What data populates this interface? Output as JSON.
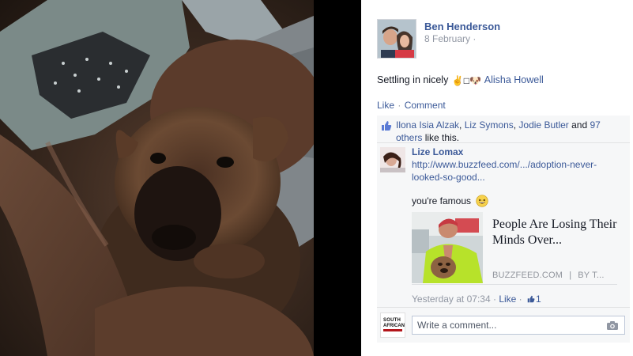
{
  "post": {
    "author": "Ben Henderson",
    "date": "8 February ·",
    "text": "Settling in nicely",
    "emoji_text": "✌️□🐶",
    "tagged": "Alisha Howell"
  },
  "actions": {
    "like": "Like",
    "separator": "·",
    "comment": "Comment"
  },
  "likes": {
    "names": [
      "Ilona Isia Alzak",
      "Liz Symons",
      "Jodie Butler"
    ],
    "sep1": ", ",
    "sep2": ", ",
    "and_text": " and ",
    "others_link": "97 others",
    "suffix": " like this."
  },
  "comment": {
    "author": "Lize Lomax",
    "url": "http://www.buzzfeed.com/.../adoption-never-looked-so-good...",
    "text": "you're famous",
    "preview": {
      "title": "People Are Losing Their Minds Over...",
      "source": "BUZZFEED.COM",
      "separator": "|",
      "by": "BY T..."
    },
    "time": "Yesterday at 07:34",
    "meta_sep": " · ",
    "like_label": "Like",
    "meta_sep2": " · ",
    "like_count": "1"
  },
  "composer": {
    "placeholder": "Write a comment...",
    "avatar_line1": "SOUTH",
    "avatar_line2": "AFRICAN"
  },
  "icons": {
    "thumb": "thumbs-up-icon",
    "smiley": "laughing-emoji-icon",
    "camera": "camera-icon"
  },
  "colors": {
    "link": "#3b5998",
    "muted": "#9197a3",
    "ufi_bg": "#f6f7f8"
  }
}
